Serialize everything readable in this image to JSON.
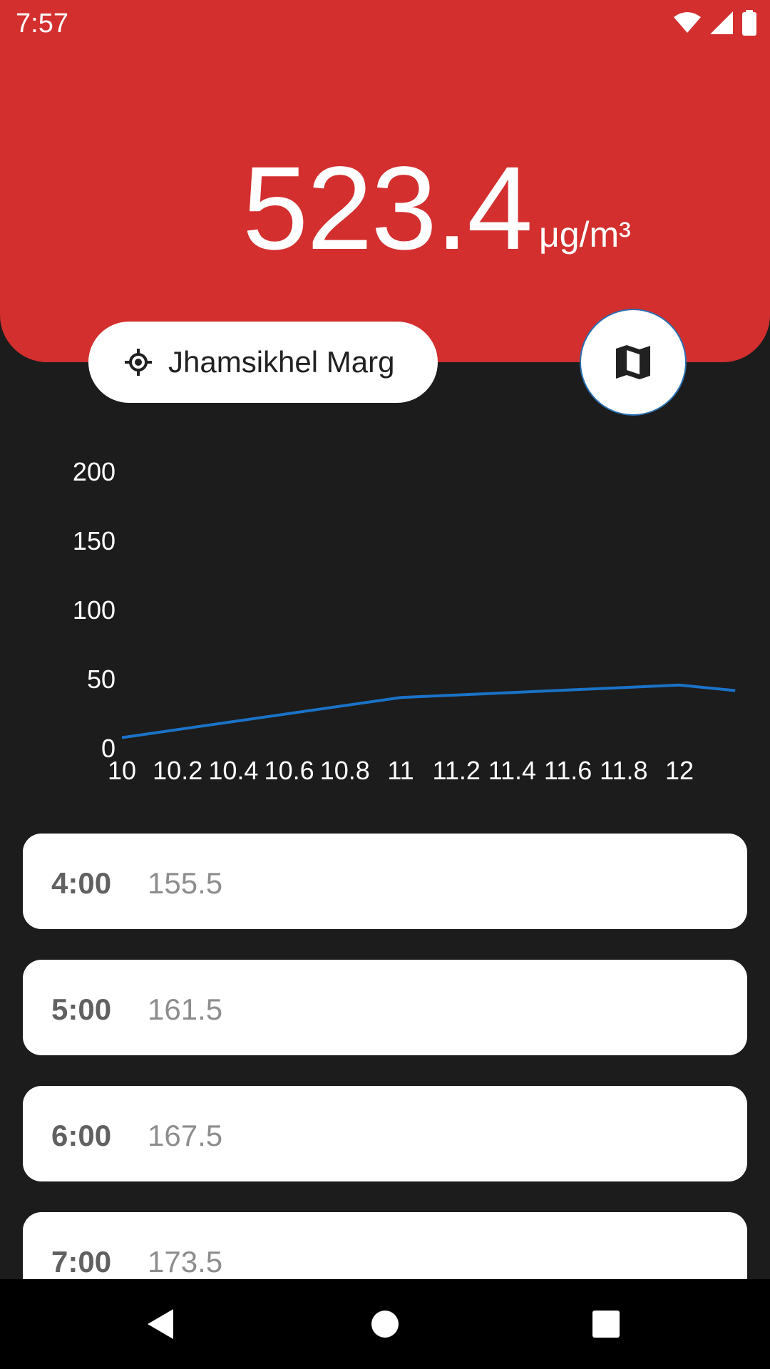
{
  "status_bar": {
    "time": "7:57",
    "icons": [
      "wifi-icon",
      "signal-icon",
      "battery-icon"
    ]
  },
  "reading": {
    "value": "523.4",
    "unit": "μg/m³",
    "header_color": "#d32f2f"
  },
  "location": {
    "icon": "my-location-icon",
    "name": "Jhamsikhel Marg"
  },
  "map_button": {
    "icon": "map-icon"
  },
  "chart_data": {
    "type": "line",
    "x": [
      10,
      11,
      12,
      12.2
    ],
    "y": [
      8,
      37,
      46,
      42
    ],
    "ylim": [
      0,
      200
    ],
    "y_ticks": [
      "0",
      "50",
      "100",
      "150",
      "200"
    ],
    "x_ticks": [
      "10",
      "10.2",
      "10.4",
      "10.6",
      "10.8",
      "11",
      "11.2",
      "11.4",
      "11.6",
      "11.8",
      "12"
    ],
    "line_color": "#1a73c8",
    "grid": false,
    "title": "",
    "xlabel": "",
    "ylabel": ""
  },
  "readings": [
    {
      "time": "4:00",
      "value": "155.5"
    },
    {
      "time": "5:00",
      "value": "161.5"
    },
    {
      "time": "6:00",
      "value": "167.5"
    },
    {
      "time": "7:00",
      "value": "173.5"
    }
  ],
  "nav_bar": {
    "back_icon": "back-icon",
    "home_icon": "home-icon",
    "recents_icon": "recents-icon"
  }
}
